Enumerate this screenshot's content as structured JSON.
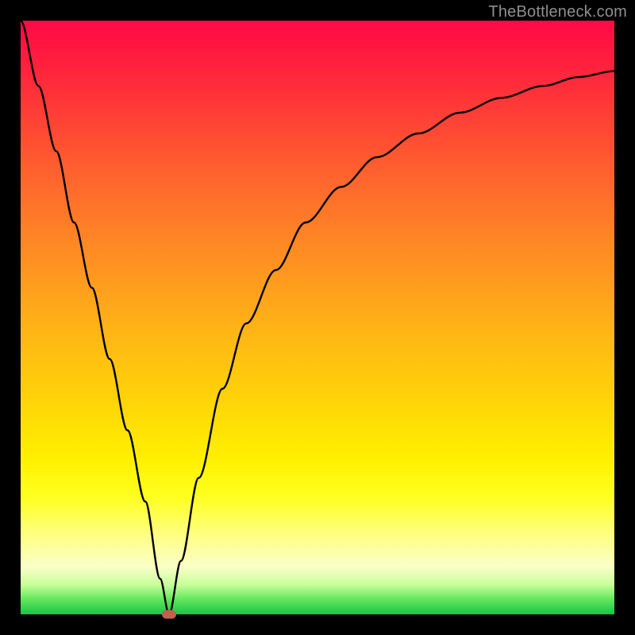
{
  "watermark": "TheBottleneck.com",
  "colors": {
    "page_bg": "#000000",
    "curve": "#000000",
    "marker": "#c1614f",
    "watermark": "#8f8f8f"
  },
  "chart_data": {
    "type": "line",
    "title": "",
    "xlabel": "",
    "ylabel": "",
    "xlim": [
      0,
      100
    ],
    "ylim": [
      0,
      100
    ],
    "grid": false,
    "series": [
      {
        "name": "bottleneck-curve",
        "x": [
          0,
          3,
          6,
          9,
          12,
          15,
          18,
          21,
          23.5,
          25,
          27,
          30,
          34,
          38,
          43,
          48,
          54,
          60,
          67,
          74,
          81,
          88,
          94,
          100
        ],
        "values": [
          100,
          89,
          78,
          66,
          55,
          43,
          31,
          19,
          6,
          0,
          9,
          23,
          38,
          49,
          58,
          66,
          72,
          77,
          81,
          84.5,
          87,
          89,
          90.5,
          91.5
        ]
      }
    ],
    "annotations": [
      {
        "name": "min-marker",
        "x": 25,
        "y": 0
      }
    ],
    "background_gradient": {
      "direction": "top-to-bottom",
      "stops": [
        {
          "offset": 0,
          "color": "#ff0a46"
        },
        {
          "offset": 0.28,
          "color": "#ff6a2c"
        },
        {
          "offset": 0.64,
          "color": "#ffd408"
        },
        {
          "offset": 0.86,
          "color": "#ffff7a"
        },
        {
          "offset": 1.0,
          "color": "#17c44a"
        }
      ]
    }
  }
}
